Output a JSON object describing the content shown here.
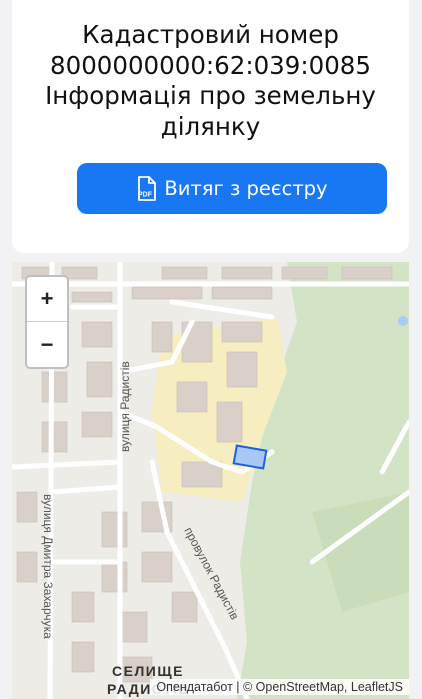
{
  "header": {
    "title_line1": "Кадастровий номер",
    "title_line2": "8000000000:62:039:0085",
    "title_line3": "Інформація про земельну",
    "title_line4": "ділянку"
  },
  "actions": {
    "extract_button_label": "Витяг з реєстру",
    "pdf_icon_text": "PDF"
  },
  "map": {
    "zoom_in_label": "+",
    "zoom_out_label": "−",
    "street_labels": {
      "radystiv_street": "вулиця Радистів",
      "zakharchuka_street": "вулиця Дмитра Захарчука",
      "radystiv_lane": "провулок Радистів",
      "village_label_line1": "СЕЛИЩЕ",
      "village_label_line2": "РАДИСТІВ"
    },
    "attribution": "Опендатабот | © OpenStreetMap, LeafletJS",
    "colors": {
      "parcel_fill": "#a9c8f5",
      "parcel_stroke": "#1f5fe0",
      "park": "#d3e4c6",
      "industrial": "#f6eec0"
    }
  },
  "colors": {
    "accent": "#1877f2"
  }
}
